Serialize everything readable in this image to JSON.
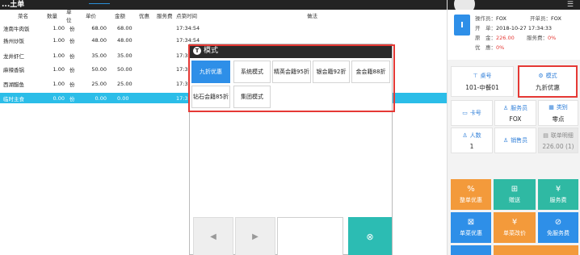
{
  "header": {
    "app_title": "...土单",
    "tab_label": ""
  },
  "table": {
    "columns": {
      "name": "菜名",
      "qty": "数量",
      "unit": "单位",
      "price": "单价",
      "amount": "金额",
      "discount": "优惠",
      "service": "服务费",
      "time": "点菜时间",
      "note": "做法"
    },
    "rows": [
      {
        "name": "淮南牛肉饭",
        "qty": "1.00",
        "unit": "份",
        "price": "68.00",
        "amount": "68.00",
        "time": "17:34:54"
      },
      {
        "name": "扬州炒饭",
        "qty": "1.00",
        "unit": "份",
        "price": "48.00",
        "amount": "48.00",
        "time": "17:34:54"
      },
      {
        "name": "龙井虾仁",
        "qty": "1.00",
        "unit": "份",
        "price": "35.00",
        "amount": "35.00",
        "time": "17:34:54"
      },
      {
        "name": "麻辣香锅",
        "qty": "1.00",
        "unit": "份",
        "price": "50.00",
        "amount": "50.00",
        "time": "17:34"
      },
      {
        "name": "西湖醋鱼",
        "qty": "1.00",
        "unit": "份",
        "price": "25.00",
        "amount": "25.00",
        "time": "17:3"
      },
      {
        "name": "临时主食",
        "qty": "0.00",
        "unit": "份",
        "price": "0.00",
        "amount": "0.00",
        "time": "17:3"
      }
    ]
  },
  "dialog": {
    "title": "模式",
    "modes": [
      "九折优惠",
      "系统模式",
      "精英会籍95折",
      "银会籍92折",
      "金会籍88折",
      "钻石会籍85折",
      "集团模式"
    ],
    "prev_icon": "chevron-left-icon",
    "next_icon": "chevron-right-icon",
    "close_icon": "close-circle-icon"
  },
  "order_info": {
    "badge": "I",
    "operator_label": "操作员：",
    "operator": "FOX",
    "opener_label": "开单员：",
    "opener": "FOX",
    "open_label": "开　单：",
    "open_time": "2018-10-27 17:34:33",
    "amount_label": "原　金：",
    "amount": "226.00",
    "service_rate_label": "服务费：",
    "service_rate": "0%",
    "discount_label": "优　惠：",
    "discount": "0%"
  },
  "tiles": {
    "table_label": "桌号",
    "table_value": "101-中餐01",
    "mode_label": "模式",
    "mode_value": "九折优惠",
    "card_label": "卡号",
    "waiter_label": "服务员",
    "waiter_value": "FOX",
    "category_label": "类别",
    "category_value": "零点",
    "guests_label": "人数",
    "guests_value": "1",
    "sales_label": "销售员",
    "detail_label": "联单明细",
    "detail_value": "226.00 (1)"
  },
  "actions": {
    "whole_discount": "整单优惠",
    "gift": "赠送",
    "service_fee": "服务费",
    "item_discount": "单菜优惠",
    "item_price": "单菜改价",
    "free_service": "免服务费"
  },
  "colors": {
    "accent": "#2e8fe8",
    "highlight_row": "#2bbde8",
    "orange": "#f39a3b",
    "teal": "#2fb9a3",
    "alert": "#e53935"
  }
}
